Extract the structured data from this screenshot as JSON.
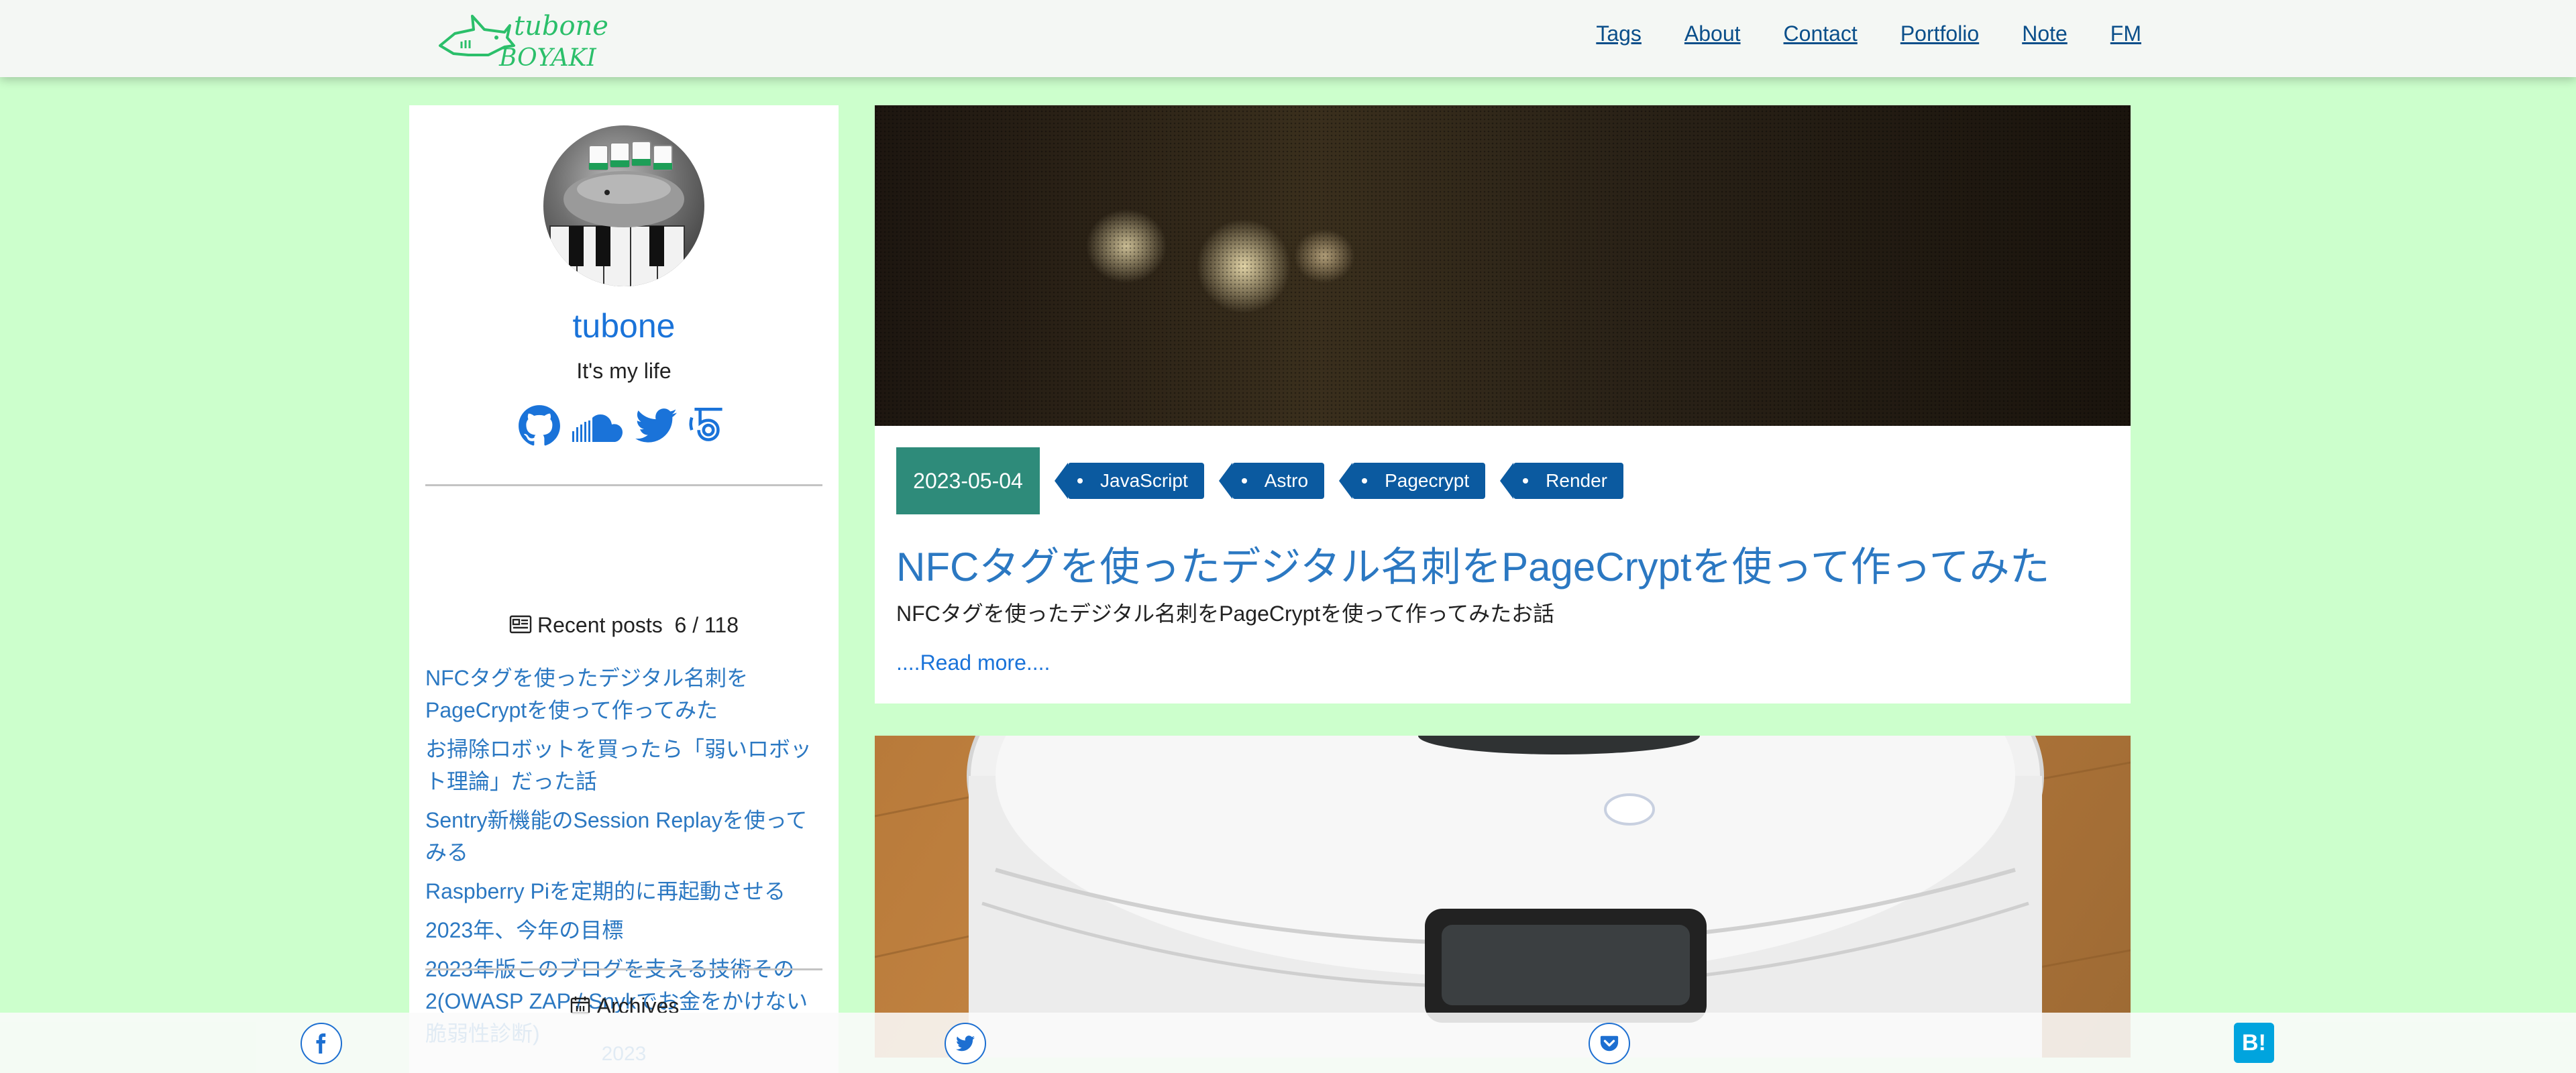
{
  "site": {
    "logo_text_top": "tubone",
    "logo_text_bottom": "BOYAKI"
  },
  "nav": {
    "items": [
      {
        "label": "Tags"
      },
      {
        "label": "About"
      },
      {
        "label": "Contact"
      },
      {
        "label": "Portfolio"
      },
      {
        "label": "Note"
      },
      {
        "label": "FM"
      }
    ]
  },
  "sidebar": {
    "author_name": "tubone",
    "author_bio": "It's my life",
    "social_icons": [
      "github-icon",
      "soundcloud-icon",
      "twitter-icon",
      "html5-icon"
    ],
    "recent_posts_title": "Recent posts",
    "recent_posts_count": "6 / 118",
    "recent_posts": [
      "NFCタグを使ったデジタル名刺をPageCryptを使って作ってみた",
      "お掃除ロボットを買ったら「弱いロボット理論」だった話",
      "Sentry新機能のSession Replayを使ってみる",
      "Raspberry Piを定期的に再起動させる",
      "2023年、今年の目標",
      "2023年版このブログを支える技術その2(OWASP ZAP / Snykでお金をかけない脆弱性診断)"
    ],
    "archives_title": "Archives",
    "archive_year": "2023"
  },
  "posts": [
    {
      "date": "2023-05-04",
      "tags": [
        "JavaScript",
        "Astro",
        "Pagecrypt",
        "Render"
      ],
      "title": "NFCタグを使ったデジタル名刺をPageCryptを使って作ってみた",
      "excerpt": "NFCタグを使ったデジタル名刺をPageCryptを使って作ってみたお話",
      "read_more": "....Read more...."
    }
  ],
  "share": {
    "buttons": [
      "facebook-icon",
      "twitter-icon",
      "pocket-icon"
    ],
    "hatena_label": "B!"
  },
  "colors": {
    "page_background": "#ccffcc",
    "link": "#2b78c2",
    "nav_link": "#0b4f8a",
    "date_badge": "#2e8b7a",
    "tag": "#0b5aa0",
    "logo_green": "#2bbf6a"
  }
}
